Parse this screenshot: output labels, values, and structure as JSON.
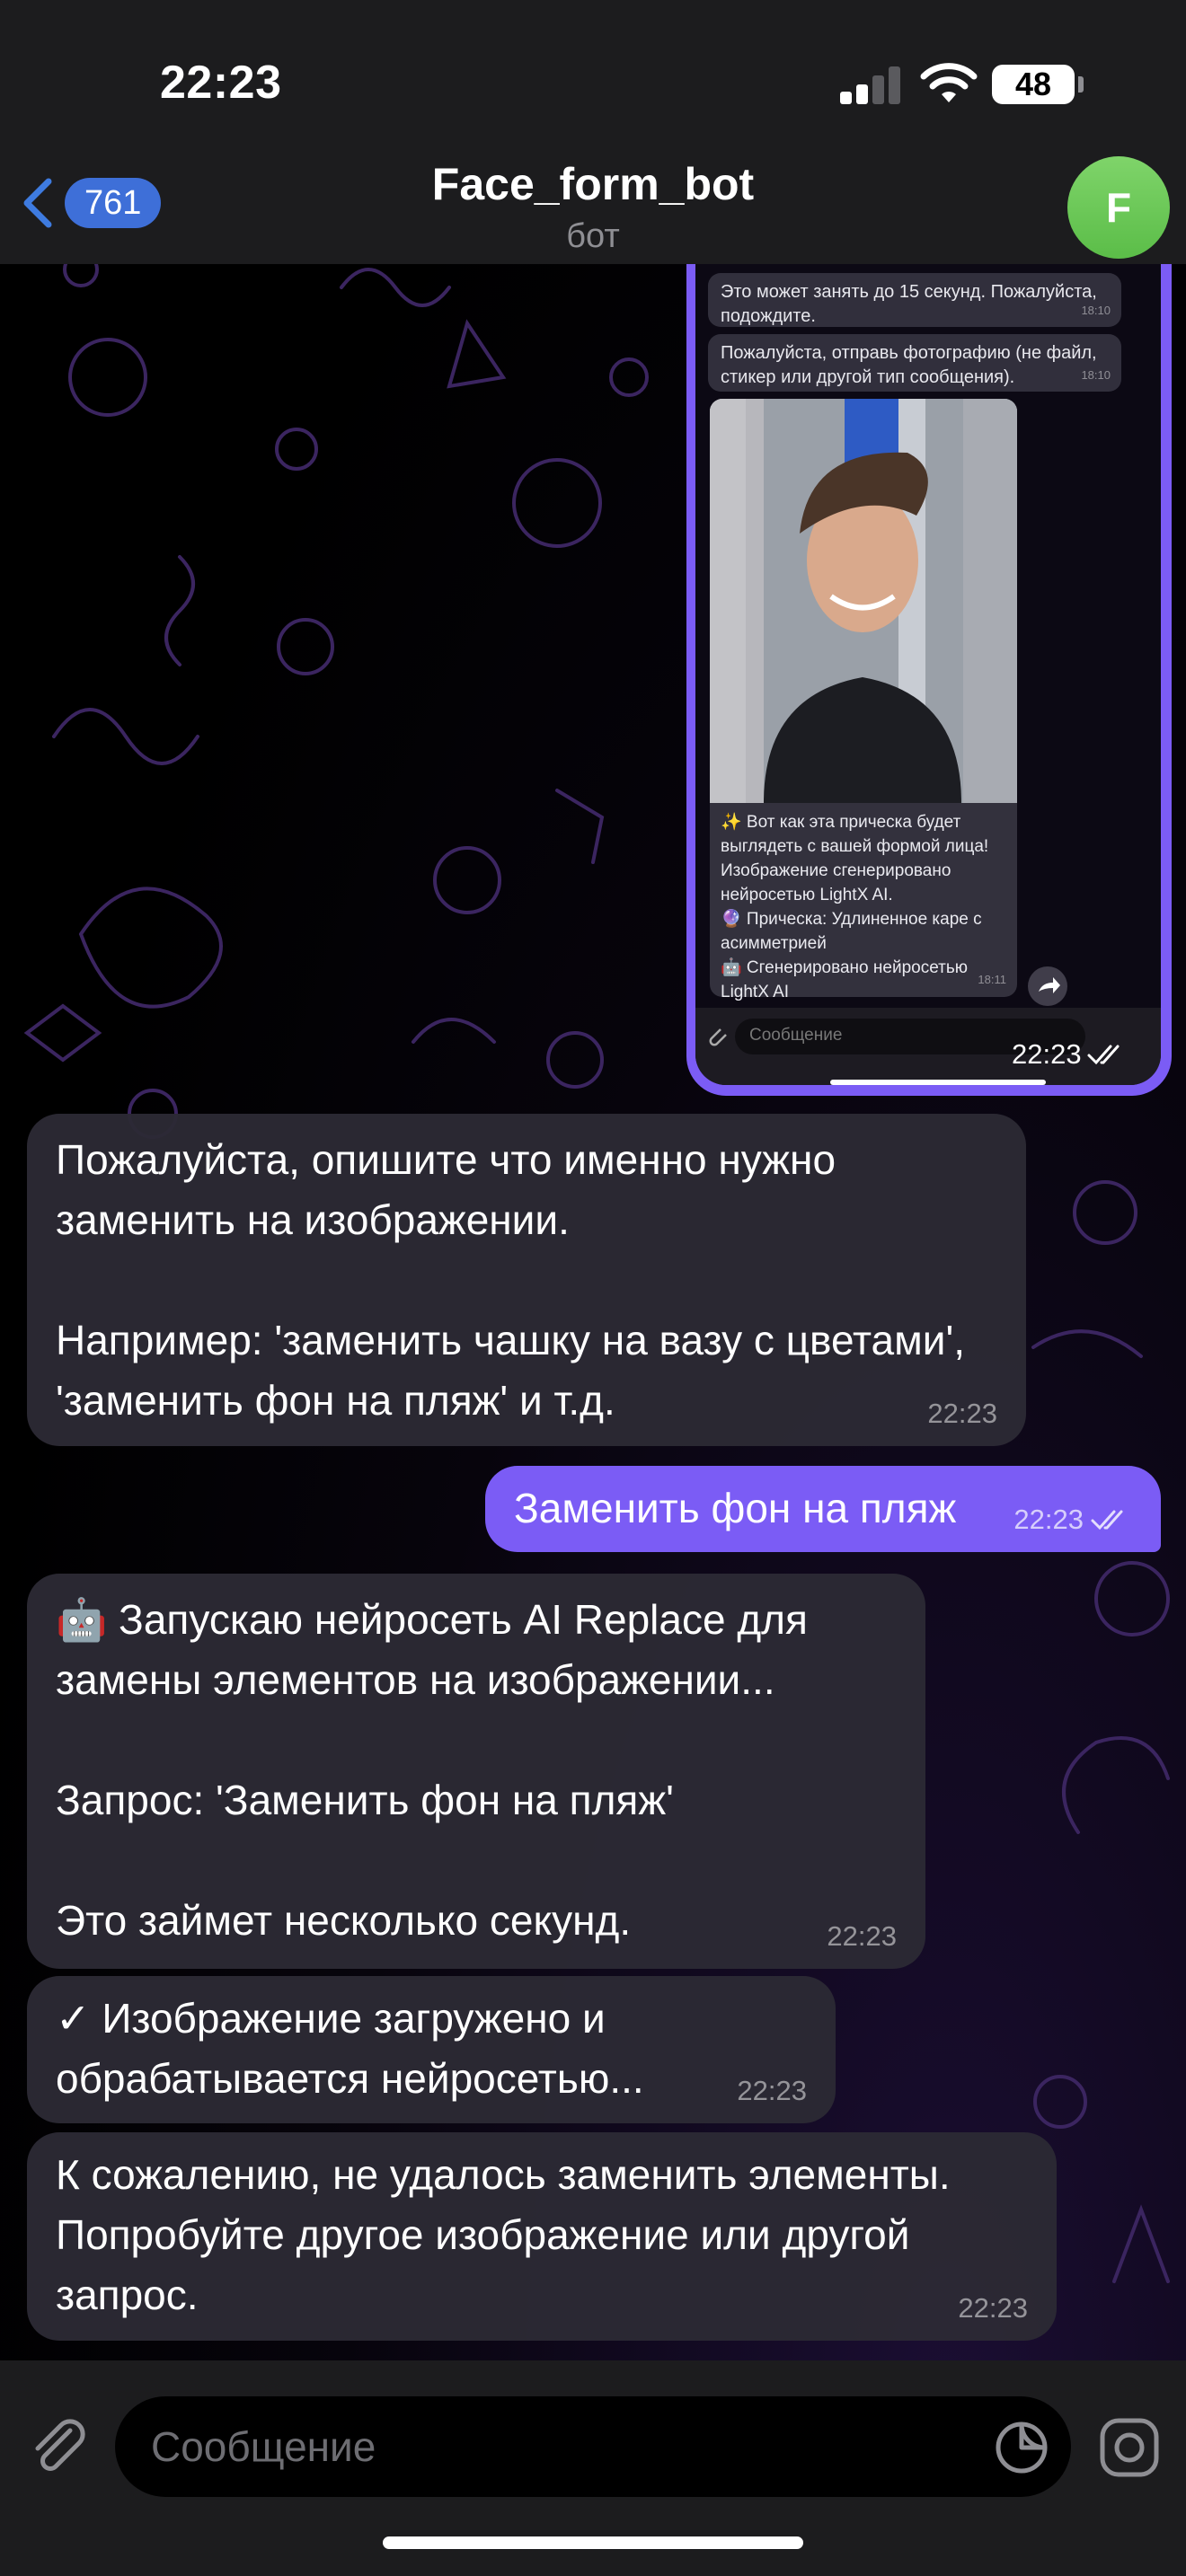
{
  "status_bar": {
    "time": "22:23",
    "battery": "48"
  },
  "header": {
    "back_count": "761",
    "title": "Face_form_bot",
    "subtitle": "бот",
    "avatar_letter": "F"
  },
  "forwarded_screenshot": {
    "msg1": "Это может занять до 15 секунд. Пожалуйста, подождите.",
    "msg1_time": "18:10",
    "msg2": "Пожалуйста, отправь фотографию (не файл, стикер или другой тип сообщения).",
    "msg2_time": "18:10",
    "caption": "✨ Вот как эта прическа будет выглядеть с вашей формой лица! Изображение сгенерировано нейросетью LightX AI.\n🔮 Прическа: Удлиненное каре с асимметрией\n🤖 Сгенерировано нейросетью LightX AI",
    "caption_time": "18:11",
    "input_placeholder": "Сообщение",
    "time": "22:23"
  },
  "messages": [
    {
      "text": "Пожалуйста, опишите что именно нужно заменить на изображении.\n\nНапример: 'заменить чашку на вазу с цветами', 'заменить фон на пляж' и т.д.",
      "time": "22:23"
    },
    {
      "text": "Заменить фон на пляж",
      "time": "22:23"
    },
    {
      "text": "🤖 Запускаю нейросеть AI Replace для замены элементов на изображении...\n\nЗапрос: 'Заменить фон на пляж'\n\nЭто займет несколько секунд.",
      "time": "22:23"
    },
    {
      "text": "✓ Изображение загружено и обрабатывается нейросетью...",
      "time": "22:23"
    },
    {
      "text": "К сожалению, не удалось заменить элементы. Попробуйте другое изображение или другой запрос.",
      "time": "22:23"
    }
  ],
  "composer": {
    "placeholder": "Сообщение"
  }
}
